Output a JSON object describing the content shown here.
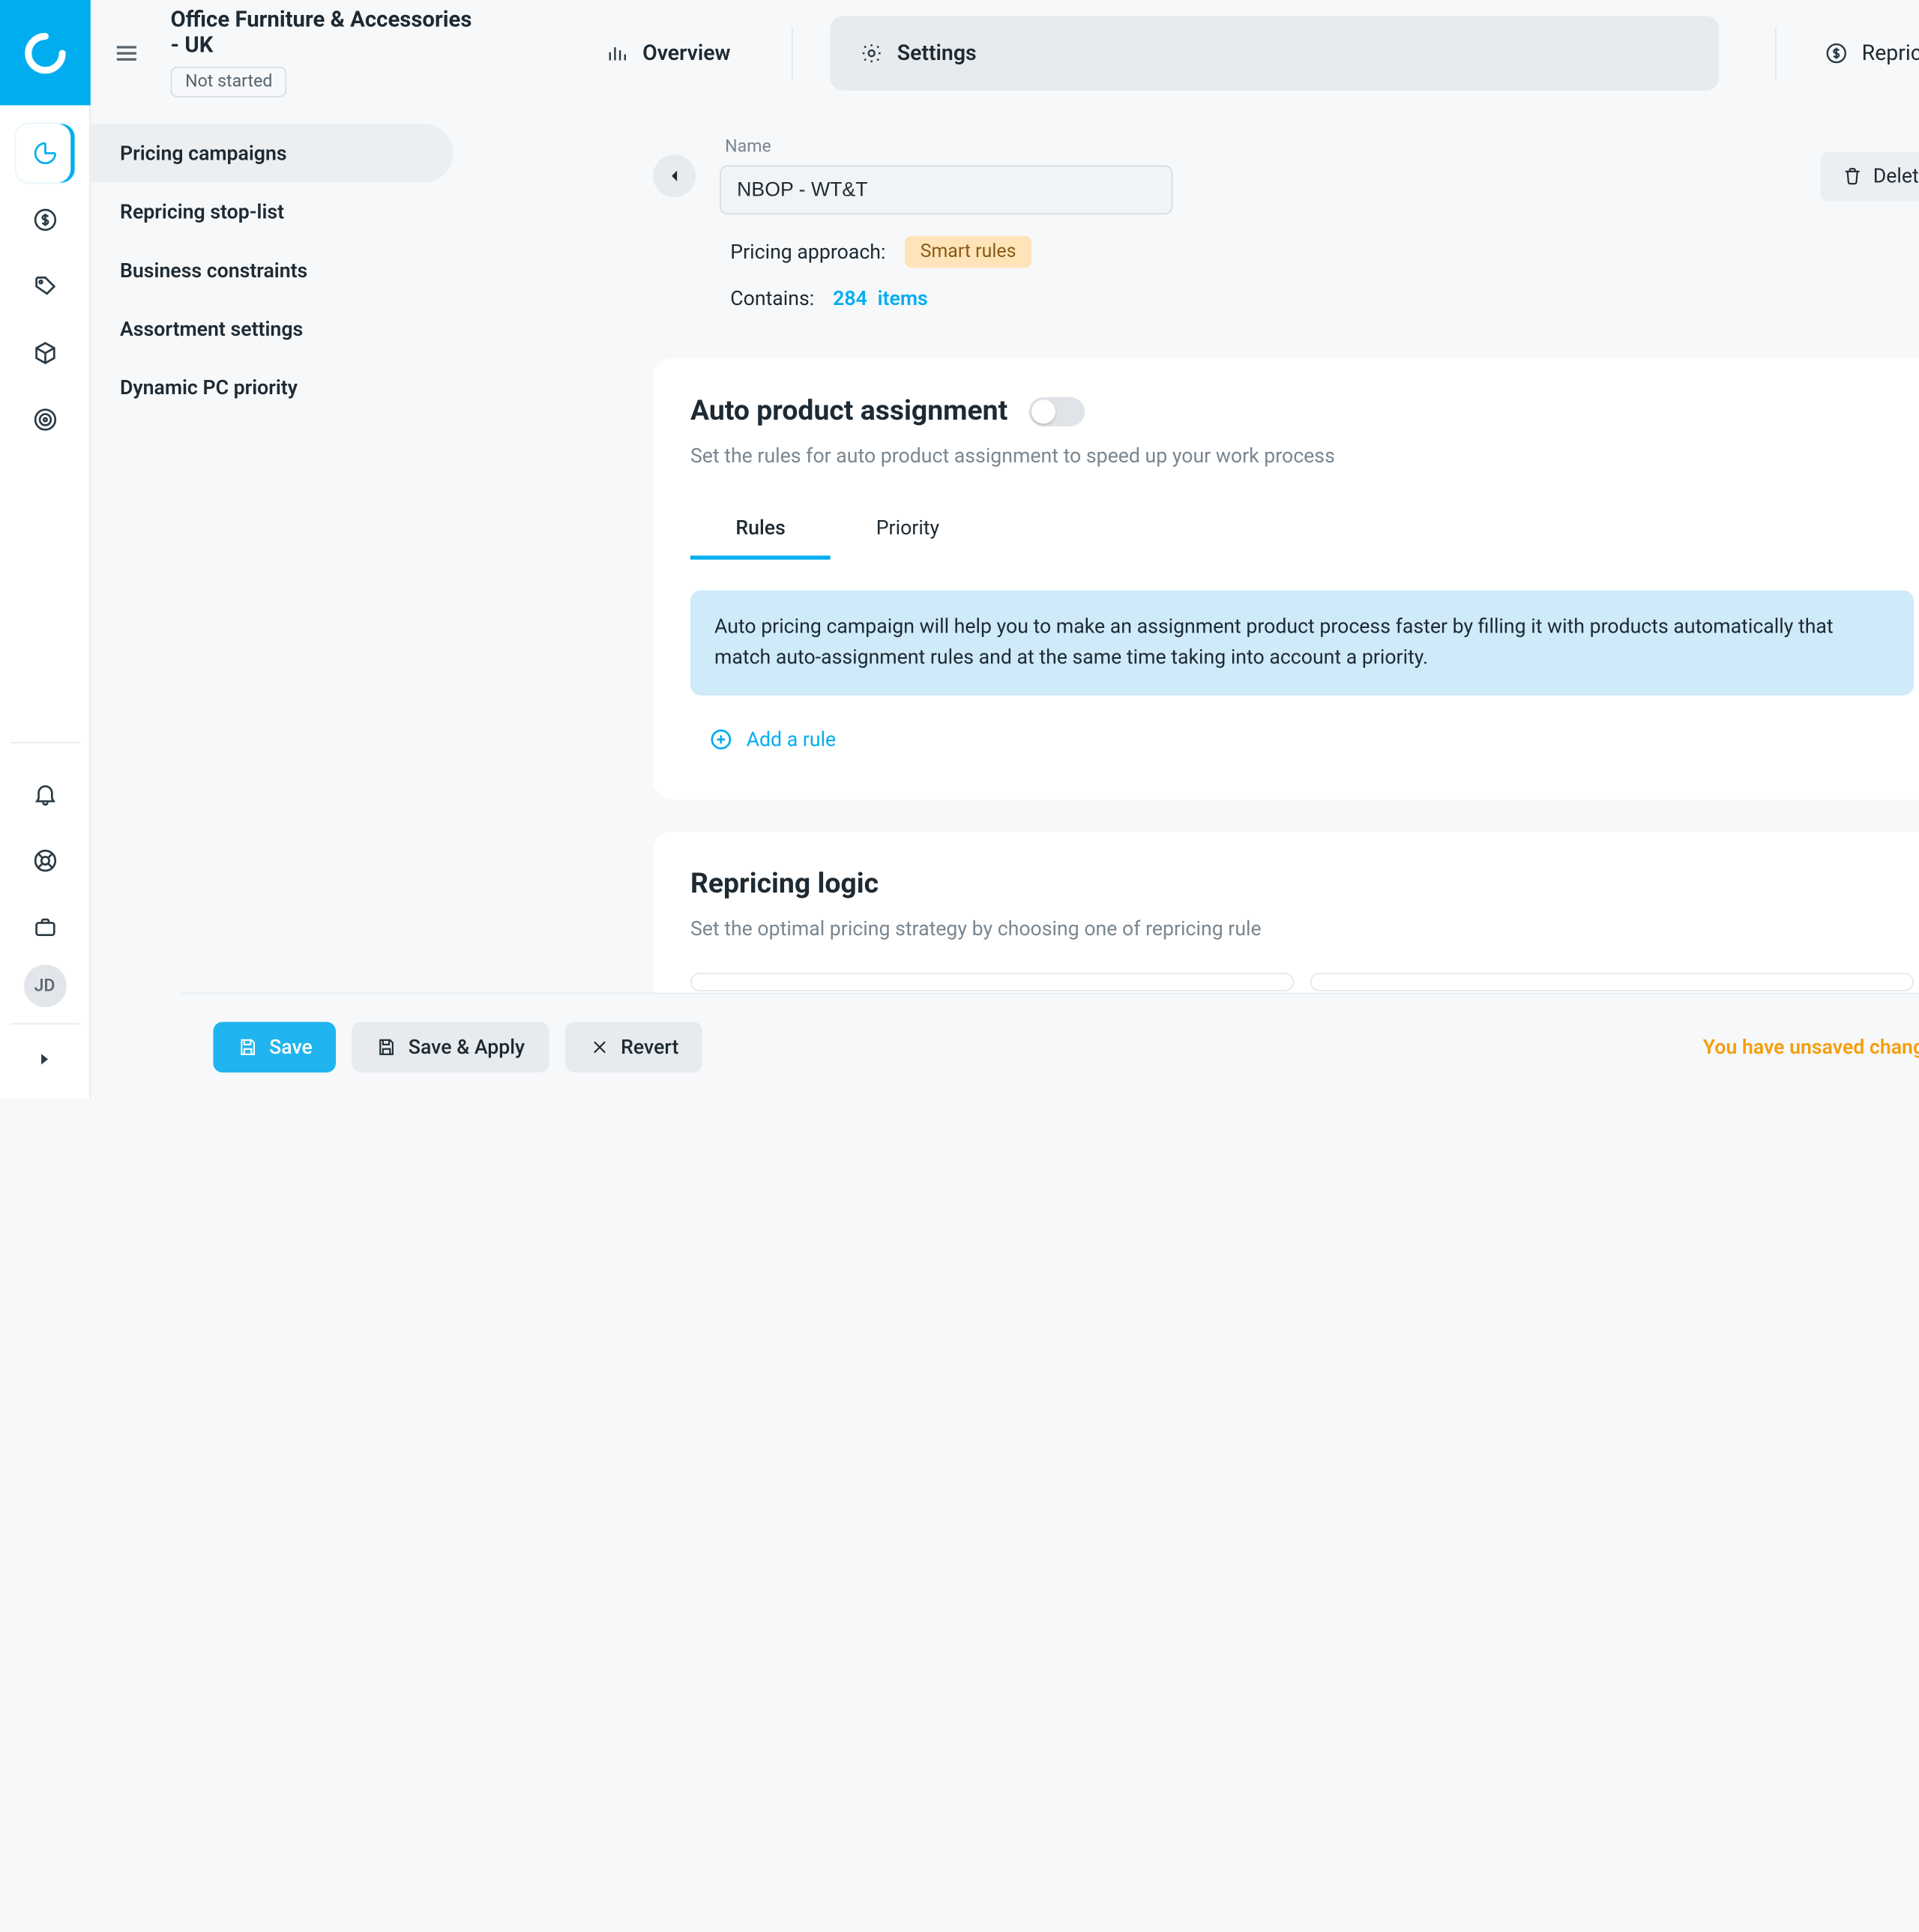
{
  "header": {
    "title": "Office Furniture & Accessories - UK",
    "status": "Not started",
    "tabs": {
      "overview": "Overview",
      "settings": "Settings"
    },
    "repricing": "Repricing"
  },
  "subnav": {
    "items": [
      "Pricing campaigns",
      "Repricing stop-list",
      "Business constraints",
      "Assortment settings",
      "Dynamic PC priority"
    ]
  },
  "detail": {
    "name_label": "Name",
    "name_value": "NBOP - WT&T",
    "delete": "Delete",
    "approach_label": "Pricing approach:",
    "approach_value": "Smart rules",
    "contains_label": "Contains:",
    "items_count": "284",
    "items_word": "items"
  },
  "auto": {
    "title": "Auto product assignment",
    "subtitle": "Set the rules for auto product assignment to speed up your work process",
    "tabs": {
      "rules": "Rules",
      "priority": "Priority"
    },
    "banner": "Auto pricing campaign will help you to make an assignment product process faster by filling it with products automatically that match auto-assignment rules and at the same time taking into account a priority.",
    "add_rule": "Add a rule"
  },
  "logic": {
    "title": "Repricing logic",
    "subtitle": "Set the optimal pricing strategy by choosing one of repricing rule"
  },
  "footer": {
    "save": "Save",
    "save_apply": "Save & Apply",
    "revert": "Revert",
    "unsaved": "You have unsaved changes!"
  },
  "avatar": "JD"
}
